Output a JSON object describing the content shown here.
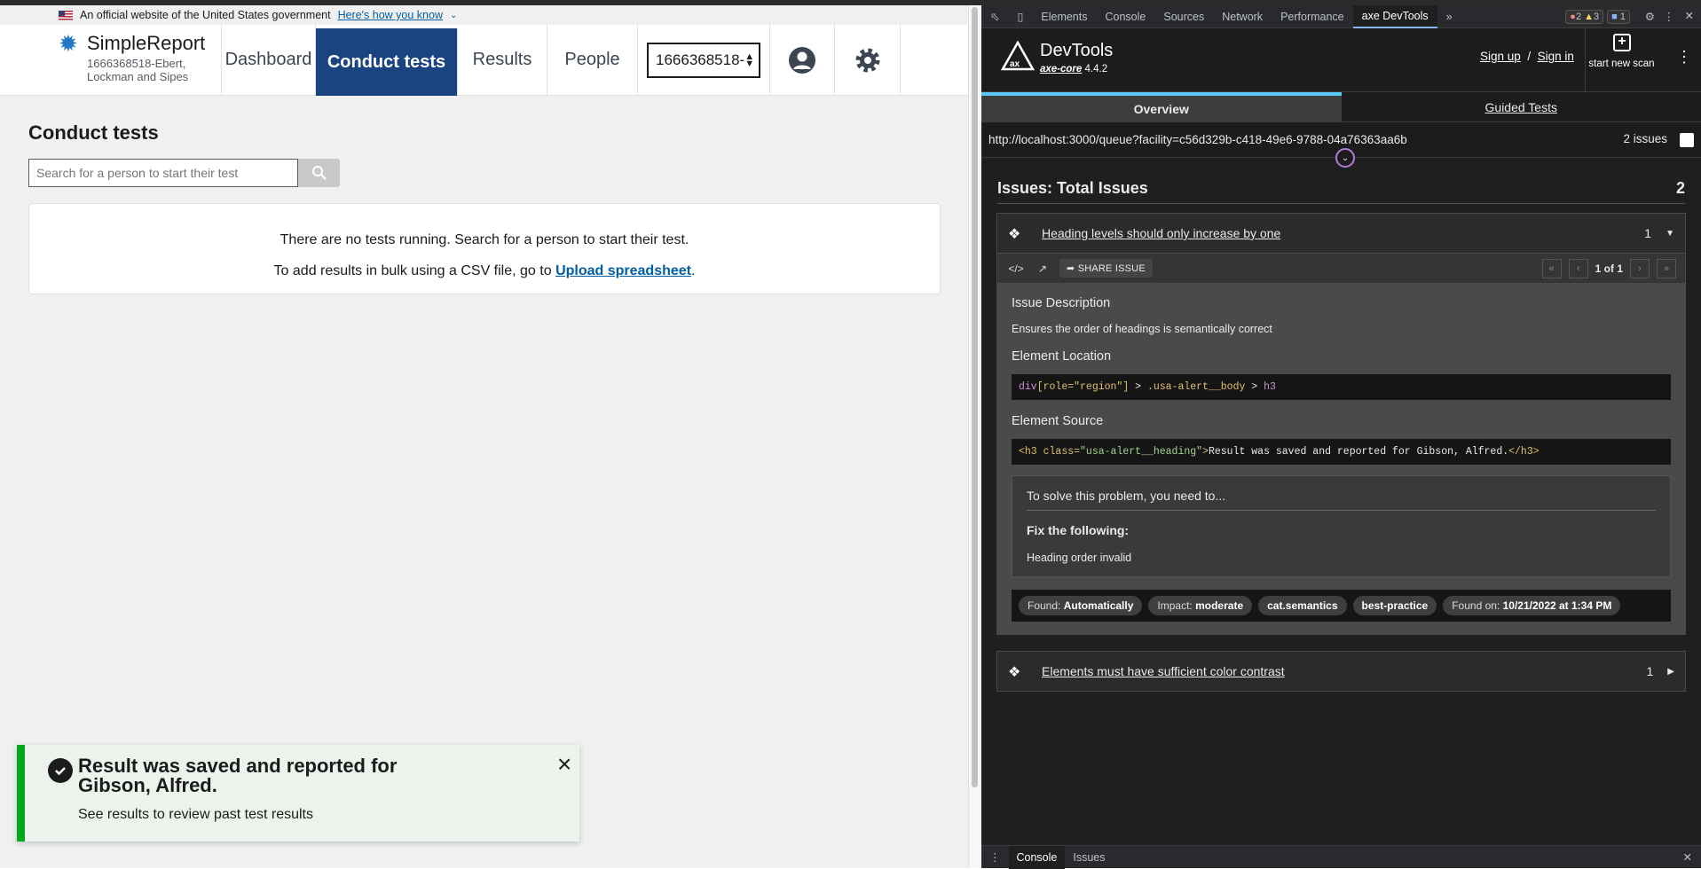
{
  "gov_banner": {
    "text": "An official website of the United States government",
    "link": "Here's how you know"
  },
  "header": {
    "app_name": "SimpleReport",
    "facility_name": "1666368518-Ebert, Lockman and Sipes",
    "nav": [
      "Dashboard",
      "Conduct tests",
      "Results",
      "People"
    ],
    "active_nav": "Conduct tests",
    "facility_select": "1666368518-"
  },
  "main": {
    "title": "Conduct tests",
    "search_placeholder": "Search for a person to start their test",
    "empty_line1": "There are no tests running. Search for a person to start their test.",
    "empty_line2_prefix": "To add results in bulk using a CSV file, go to ",
    "empty_line2_link": "Upload spreadsheet",
    "empty_line2_suffix": "."
  },
  "toast": {
    "title": "Result was saved and reported for Gibson, Alfred.",
    "body": "See results to review past test results",
    "close": "×"
  },
  "devtools": {
    "tabs": [
      "Elements",
      "Console",
      "Sources",
      "Network",
      "Performance",
      "axe DevTools"
    ],
    "active_tab": "axe DevTools",
    "errors": "2",
    "warnings": "3",
    "messages": "1"
  },
  "axe": {
    "title": "DevTools",
    "core": "axe-core",
    "version": "4.4.2",
    "sign_up": "Sign up",
    "sep": "/",
    "sign_in": "Sign in",
    "scan_label": "start new scan",
    "tab_overview": "Overview",
    "tab_guided": "Guided Tests",
    "url": "http://localhost:3000/queue?facility=c56d329b-c418-49e6-9788-04a76363aa6b",
    "issue_count_label": "2 issues",
    "issues_title": "Issues: Total Issues",
    "issues_total": "2",
    "issues": [
      {
        "name": "Heading levels should only increase by one",
        "count": "1",
        "expanded": true,
        "share": "SHARE ISSUE",
        "pager": "1 of 1",
        "desc_h": "Issue Description",
        "desc": "Ensures the order of headings is semantically correct",
        "loc_h": "Element Location",
        "src_h": "Element Source",
        "loc_parts": {
          "a": "div",
          "b": "[role=\"region\"]",
          "c": " > ",
          "d": ".usa-alert__body",
          "e": " > ",
          "f": "h3"
        },
        "src_parts": {
          "a": "<h3 ",
          "b": "class=",
          "c": "\"usa-alert__heading\"",
          "d": ">",
          "e": "Result was saved and reported for Gibson, Alfred.",
          "f": "</h3>"
        },
        "solve_h": "To solve this problem, you need to...",
        "fix_h": "Fix the following:",
        "fix_msg": "Heading order invalid",
        "tags": {
          "found_k": "Found:",
          "found_v": "Automatically",
          "impact_k": "Impact:",
          "impact_v": "moderate",
          "t1": "cat.semantics",
          "t2": "best-practice",
          "foundon_k": "Found on:",
          "foundon_v": "10/21/2022 at 1:34 PM"
        }
      },
      {
        "name": "Elements must have sufficient color contrast",
        "count": "1",
        "expanded": false
      }
    ]
  },
  "console_bar": {
    "tabs": [
      "Console",
      "Issues"
    ]
  }
}
